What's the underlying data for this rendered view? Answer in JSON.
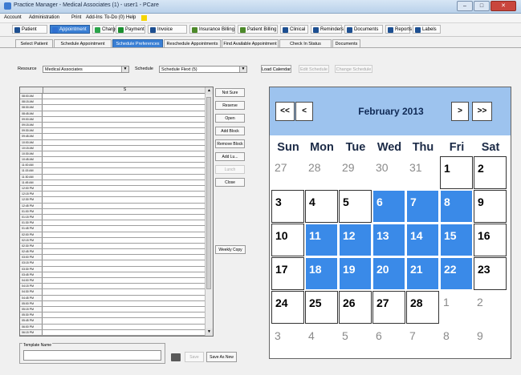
{
  "window": {
    "title": "Practice Manager - Medical Associates (1) - user1 - PCare",
    "minimize": "–",
    "maximize": "□",
    "close": "✕"
  },
  "menu": [
    "Account",
    "Administration",
    "Print",
    "Add-Ins",
    "To-Do (0)",
    "Help"
  ],
  "toolbar": [
    {
      "label": "Patient",
      "icon": "patient-icon",
      "color": "#1d4f91"
    },
    {
      "label": "Appointment",
      "icon": "appointment-icon",
      "color": "#2f6fd0",
      "active": true
    },
    {
      "label": "Charge",
      "icon": "charge-icon",
      "color": "#2aa44a"
    },
    {
      "label": "Payment",
      "icon": "payment-icon",
      "color": "#1a8f2f"
    },
    {
      "label": "Invoice",
      "icon": "invoice-icon",
      "color": "#1d4f91"
    },
    {
      "label": "Insurance Billing",
      "icon": "insurance-billing-icon",
      "color": "#4d8a2a"
    },
    {
      "label": "Patient Billing",
      "icon": "patient-billing-icon",
      "color": "#4d8a2a"
    },
    {
      "label": "Clinical",
      "icon": "clinical-icon",
      "color": "#1d4f91"
    },
    {
      "label": "Reminders",
      "icon": "reminders-icon",
      "color": "#1d4f91"
    },
    {
      "label": "Documents",
      "icon": "documents-icon",
      "color": "#1d4f91"
    },
    {
      "label": "Reports",
      "icon": "reports-icon",
      "color": "#1d4f91"
    },
    {
      "label": "Labels",
      "icon": "labels-icon",
      "color": "#1d4f91"
    }
  ],
  "subtabs": [
    {
      "label": "Select Patient"
    },
    {
      "label": "Schedule Appointment"
    },
    {
      "label": "Schedule Preferences",
      "active": true
    },
    {
      "label": "Reschedule Appointments"
    },
    {
      "label": "Find Available Appointment"
    },
    {
      "label": "Check In Status"
    },
    {
      "label": "Documents"
    }
  ],
  "filters": {
    "resource_label": "Resource",
    "resource_value": "Medical Associates",
    "schedule_label": "Schedule",
    "schedule_value": "Schedule Flext (5)",
    "load_calendar": "Load Calendar",
    "edit_schedule": "Edit Schedule",
    "change_schedule": "Change Schedule"
  },
  "grid": {
    "column_header": "S",
    "times": [
      "08:00 AM",
      "08:15 AM",
      "08:30 AM",
      "08:45 AM",
      "09:00 AM",
      "09:15 AM",
      "09:30 AM",
      "09:45 AM",
      "10:00 AM",
      "10:15 AM",
      "10:30 AM",
      "10:45 AM",
      "11:00 AM",
      "11:15 AM",
      "11:30 AM",
      "11:45 AM",
      "12:00 PM",
      "12:15 PM",
      "12:30 PM",
      "12:45 PM",
      "01:00 PM",
      "01:15 PM",
      "01:30 PM",
      "01:45 PM",
      "02:00 PM",
      "02:15 PM",
      "02:30 PM",
      "02:45 PM",
      "03:00 PM",
      "03:15 PM",
      "03:30 PM",
      "03:45 PM",
      "04:00 PM",
      "04:15 PM",
      "04:30 PM",
      "04:45 PM",
      "05:00 PM",
      "05:15 PM",
      "05:30 PM",
      "05:45 PM",
      "06:00 PM",
      "06:15 PM"
    ]
  },
  "side_buttons": [
    "Not Sure",
    "Reserve",
    "Open",
    "Add Block",
    "Remove Block",
    "Add Lu...",
    "Lunch",
    "Close"
  ],
  "weekly_copy": "Weekly Copy",
  "template": {
    "caption": "Template Name",
    "save": "Save",
    "save_as_new": "Save As New"
  },
  "calendar": {
    "month_label": "February 2013",
    "prev_year": "<<",
    "prev_month": "<",
    "next_month": ">",
    "next_year": ">>",
    "dow": [
      "Sun",
      "Mon",
      "Tue",
      "Wed",
      "Thu",
      "Fri",
      "Sat"
    ],
    "weeks": [
      [
        {
          "d": "27",
          "t": "o"
        },
        {
          "d": "28",
          "t": "o"
        },
        {
          "d": "29",
          "t": "o"
        },
        {
          "d": "30",
          "t": "o"
        },
        {
          "d": "31",
          "t": "o"
        },
        {
          "d": "1",
          "t": "c"
        },
        {
          "d": "2",
          "t": "c"
        }
      ],
      [
        {
          "d": "3",
          "t": "c"
        },
        {
          "d": "4",
          "t": "c"
        },
        {
          "d": "5",
          "t": "c"
        },
        {
          "d": "6",
          "t": "s"
        },
        {
          "d": "7",
          "t": "s"
        },
        {
          "d": "8",
          "t": "s"
        },
        {
          "d": "9",
          "t": "c"
        }
      ],
      [
        {
          "d": "10",
          "t": "c"
        },
        {
          "d": "11",
          "t": "s"
        },
        {
          "d": "12",
          "t": "s"
        },
        {
          "d": "13",
          "t": "s"
        },
        {
          "d": "14",
          "t": "s"
        },
        {
          "d": "15",
          "t": "s"
        },
        {
          "d": "16",
          "t": "c"
        }
      ],
      [
        {
          "d": "17",
          "t": "c"
        },
        {
          "d": "18",
          "t": "s"
        },
        {
          "d": "19",
          "t": "s"
        },
        {
          "d": "20",
          "t": "s"
        },
        {
          "d": "21",
          "t": "s"
        },
        {
          "d": "22",
          "t": "s"
        },
        {
          "d": "23",
          "t": "c"
        }
      ],
      [
        {
          "d": "24",
          "t": "c"
        },
        {
          "d": "25",
          "t": "c"
        },
        {
          "d": "26",
          "t": "c"
        },
        {
          "d": "27",
          "t": "c"
        },
        {
          "d": "28",
          "t": "c"
        },
        {
          "d": "1",
          "t": "o"
        },
        {
          "d": "2",
          "t": "o"
        }
      ],
      [
        {
          "d": "3",
          "t": "o"
        },
        {
          "d": "4",
          "t": "o"
        },
        {
          "d": "5",
          "t": "o"
        },
        {
          "d": "6",
          "t": "o"
        },
        {
          "d": "7",
          "t": "o"
        },
        {
          "d": "8",
          "t": "o"
        },
        {
          "d": "9",
          "t": "o"
        }
      ]
    ]
  }
}
